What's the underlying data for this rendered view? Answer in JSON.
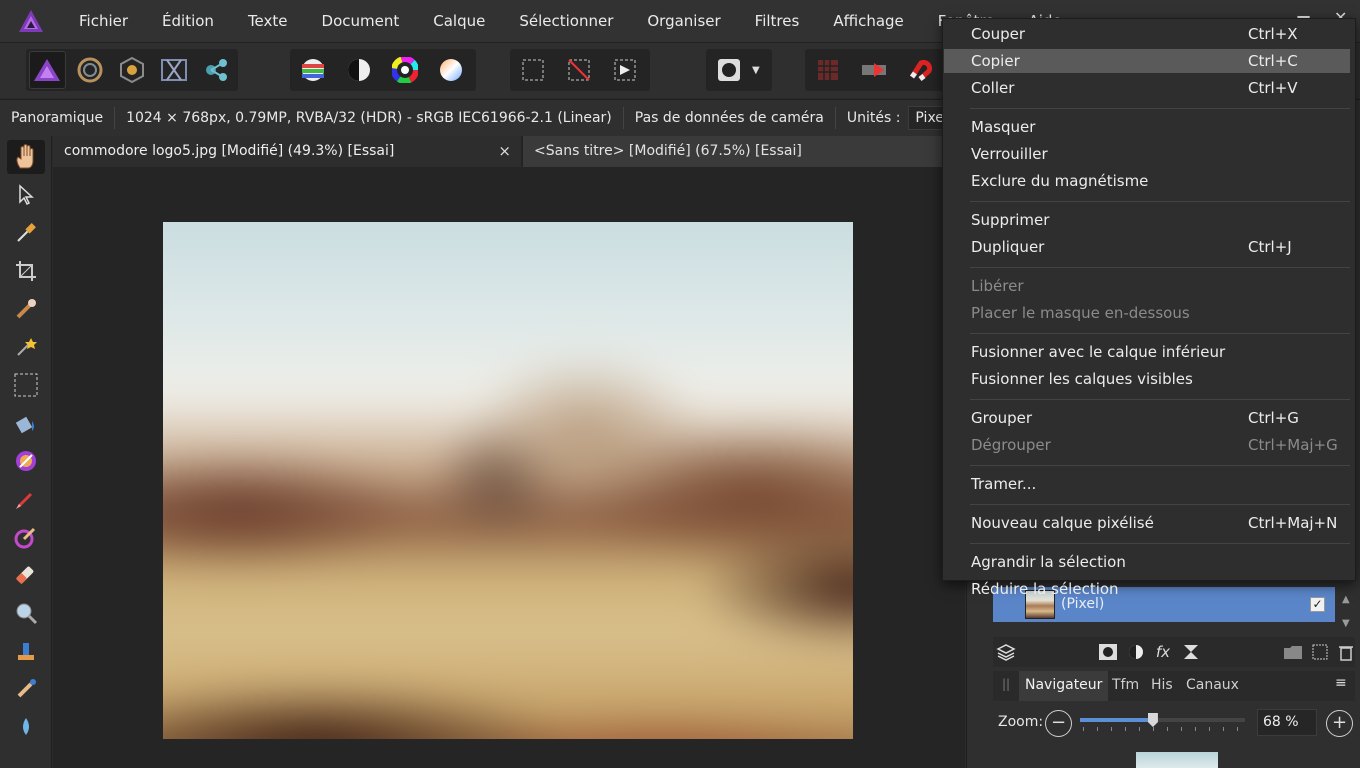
{
  "menubar": {
    "items": [
      "Fichier",
      "Édition",
      "Texte",
      "Document",
      "Calque",
      "Sélectionner",
      "Organiser",
      "Filtres",
      "Affichage",
      "Fenêtre",
      "Aide"
    ]
  },
  "context": {
    "persona": "Panoramique",
    "info": "1024 × 768px, 0.79MP, RVBA/32 (HDR) - sRGB IEC61966-2.1 (Linear)",
    "camera": "Pas de données de caméra",
    "units_label": "Unités :",
    "units_value": "Pixels"
  },
  "tabs": [
    {
      "label": "commodore logo5.jpg [Modifié] (49.3%) [Essai]",
      "close": "×"
    },
    {
      "label": "<Sans titre> [Modifié] (67.5%) [Essai]"
    }
  ],
  "context_menu": {
    "items": [
      {
        "label": "Couper",
        "shortcut": "Ctrl+X"
      },
      {
        "label": "Copier",
        "shortcut": "Ctrl+C"
      },
      {
        "label": "Coller",
        "shortcut": "Ctrl+V"
      },
      {
        "label": "Masquer",
        "shortcut": ""
      },
      {
        "label": "Verrouiller",
        "shortcut": ""
      },
      {
        "label": "Exclure du magnétisme",
        "shortcut": ""
      },
      {
        "label": "Supprimer",
        "shortcut": ""
      },
      {
        "label": "Dupliquer",
        "shortcut": "Ctrl+J"
      },
      {
        "label": "Libérer",
        "shortcut": ""
      },
      {
        "label": "Placer le masque en-dessous",
        "shortcut": ""
      },
      {
        "label": "Fusionner avec le calque inférieur",
        "shortcut": ""
      },
      {
        "label": "Fusionner les calques visibles",
        "shortcut": ""
      },
      {
        "label": "Grouper",
        "shortcut": "Ctrl+G"
      },
      {
        "label": "Dégrouper",
        "shortcut": "Ctrl+Maj+G"
      },
      {
        "label": "Tramer...",
        "shortcut": ""
      },
      {
        "label": "Nouveau calque pixélisé",
        "shortcut": "Ctrl+Maj+N"
      },
      {
        "label": "Agrandir la sélection",
        "shortcut": ""
      },
      {
        "label": "Réduire la sélection",
        "shortcut": ""
      }
    ],
    "highlighted": "Copier",
    "disabled": [
      "Libérer",
      "Placer le masque en-dessous",
      "Dégrouper"
    ]
  },
  "layers": {
    "layer_name": "(Pixel)"
  },
  "navigator": {
    "tabs": [
      "Navigateur",
      "Tfm",
      "His",
      "Canaux"
    ],
    "zoom_label": "Zoom:",
    "zoom_value": "68 %",
    "zoom_level": 68
  },
  "colors": {
    "accent": "#5a85c8",
    "menu_highlight": "#5a5a5a"
  }
}
